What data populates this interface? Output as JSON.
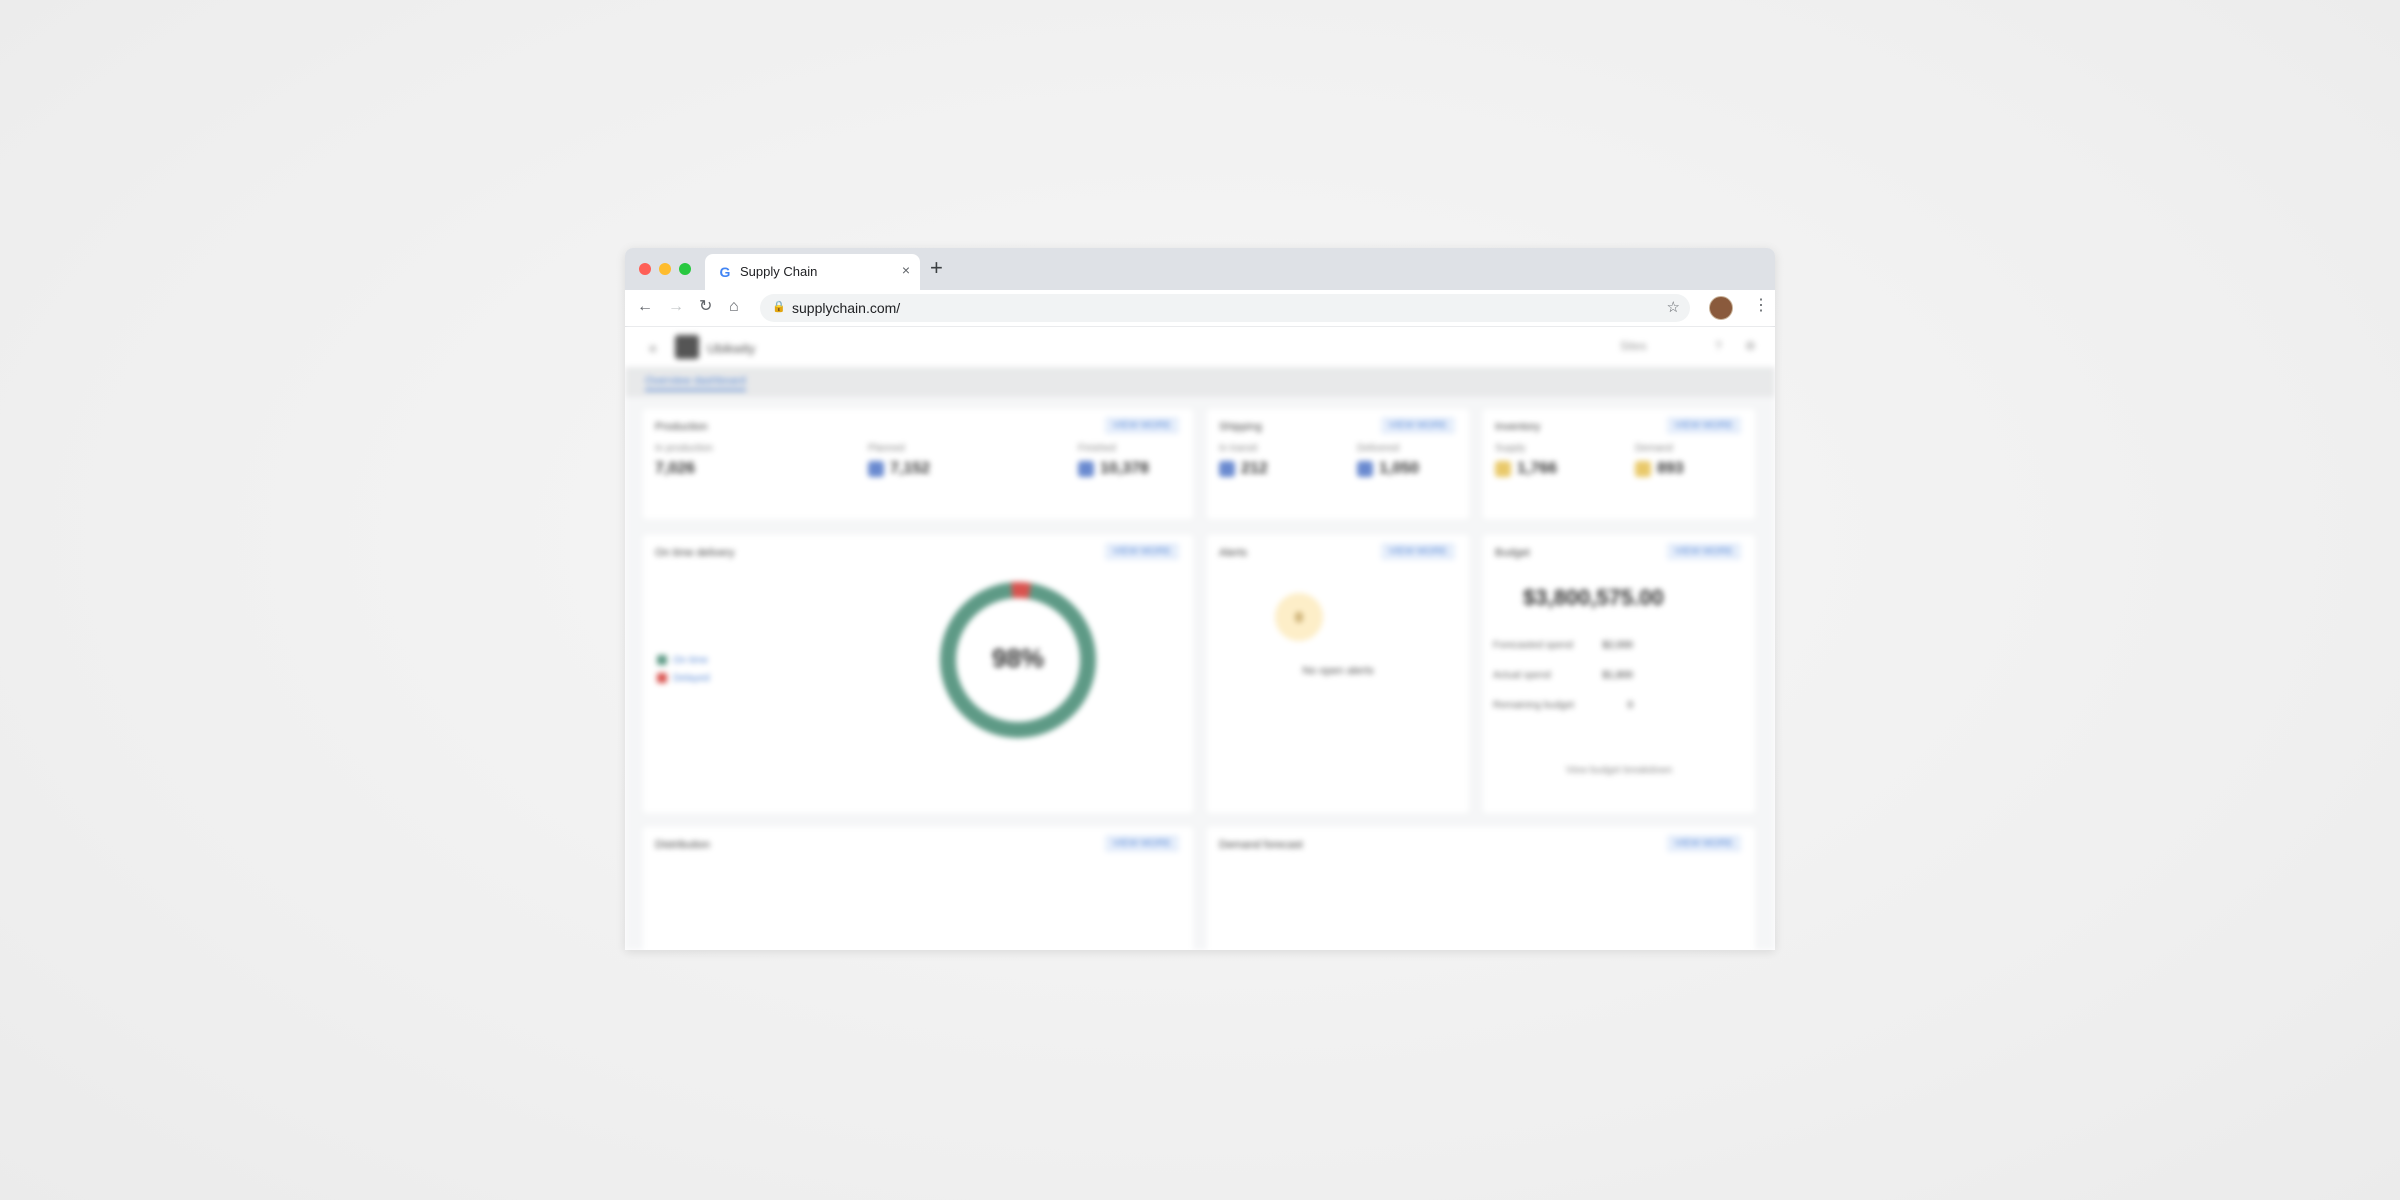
{
  "browser": {
    "tab_title": "Supply Chain",
    "tab_favicon": "G",
    "tab_close": "×",
    "new_tab": "+",
    "url": "supplychain.com/",
    "lock_icon": "🔒",
    "back_icon": "←",
    "forward_icon": "→",
    "reload_icon": "↻",
    "home_icon": "⌂",
    "star_icon": "☆",
    "kebab_icon": "⋮"
  },
  "app": {
    "menu_icon": "≡",
    "name": "Ubikwity",
    "header_controls": [
      "Sites",
      "?",
      "⚙"
    ],
    "subnav_tab": "Overview dashboard"
  },
  "cards": {
    "production": {
      "title": "Production",
      "button": "VIEW MORE",
      "metrics": [
        {
          "label": "In production",
          "value": "7,026",
          "chip": ""
        },
        {
          "label": "Planned",
          "value": "7,152",
          "chip": "#6a8ad0"
        },
        {
          "label": "Finished",
          "value": "10,378",
          "chip": "#6a8ad0"
        }
      ]
    },
    "shipping": {
      "title": "Shipping",
      "button": "VIEW MORE",
      "metrics": [
        {
          "label": "In transit",
          "value": "212",
          "chip": "#6a8ad0"
        },
        {
          "label": "Delivered",
          "value": "1,050",
          "chip": "#6a8ad0"
        }
      ]
    },
    "inventory": {
      "title": "Inventory",
      "button": "VIEW MORE",
      "metrics": [
        {
          "label": "Supply",
          "value": "1,766",
          "chip": "#e9c96a"
        },
        {
          "label": "Demand",
          "value": "893",
          "chip": "#e9c96a"
        }
      ]
    },
    "on_time": {
      "title": "On time delivery",
      "button": "VIEW MORE",
      "donut_value": "98%",
      "legend": [
        "On time",
        "Delayed"
      ],
      "colors": {
        "on_time": "#5e9a86",
        "delayed": "#d9534f"
      }
    },
    "alerts": {
      "title": "Alerts",
      "button": "VIEW MORE",
      "badge": "0",
      "text": "No open alerts"
    },
    "budget": {
      "title": "Budget",
      "button": "VIEW MORE",
      "amount": "$3,800,575.00",
      "rows": [
        {
          "label": "Forecasted spend",
          "value": "$2,000"
        },
        {
          "label": "Actual spend",
          "value": "$1,800"
        },
        {
          "label": "Remaining budget",
          "value": "0"
        }
      ],
      "footer": "View budget breakdown"
    },
    "distribution": {
      "title": "Distribution",
      "button": "VIEW MORE"
    },
    "demand_forecast": {
      "title": "Demand forecast",
      "button": "VIEW MORE"
    }
  }
}
